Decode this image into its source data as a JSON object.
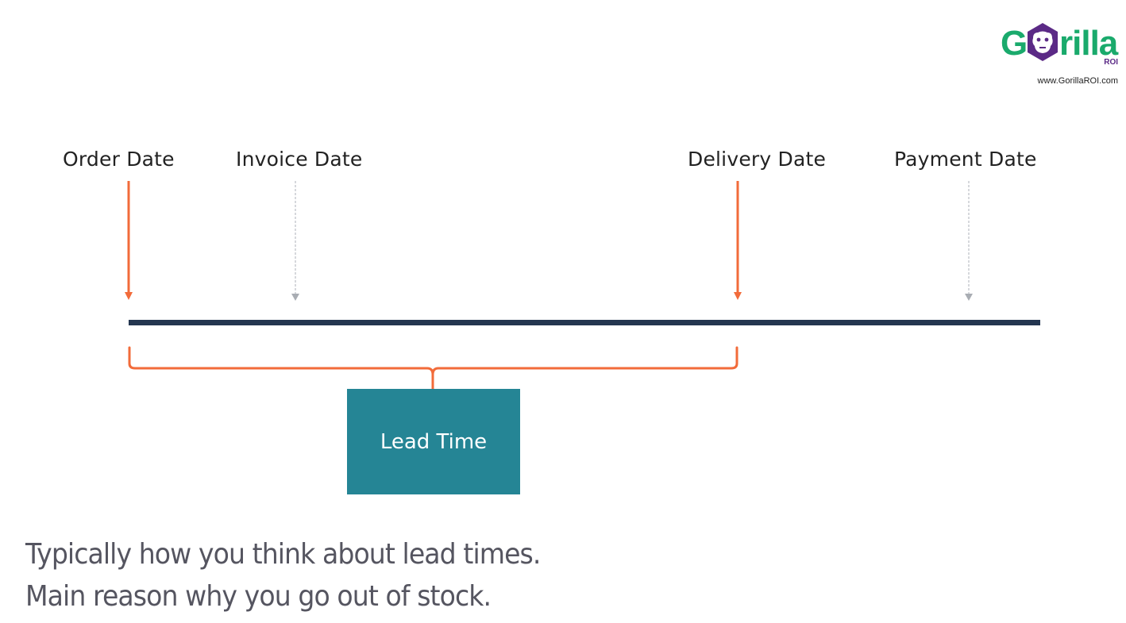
{
  "timeline": {
    "milestones": [
      {
        "label": "Order Date",
        "style": "solid",
        "color": "#f26b3a"
      },
      {
        "label": "Invoice Date",
        "style": "dashed",
        "color": "#a9adb3"
      },
      {
        "label": "Delivery Date",
        "style": "solid",
        "color": "#f26b3a"
      },
      {
        "label": "Payment Date",
        "style": "dashed",
        "color": "#a9adb3"
      }
    ],
    "line_color": "#243650",
    "bracket_color": "#f26b3a",
    "bracket_span": [
      "Order Date",
      "Delivery Date"
    ]
  },
  "lead_time_box": {
    "label": "Lead Time",
    "color": "#258595"
  },
  "caption": {
    "line1": "Typically how you think about lead times.",
    "line2": "Main reason why you go out of stock."
  },
  "logo": {
    "g": "G",
    "rilla": "rilla",
    "sub": "ROI",
    "url": "www.GorillaROI.com",
    "green": "#1aaa6c",
    "purple": "#5b2a86"
  }
}
